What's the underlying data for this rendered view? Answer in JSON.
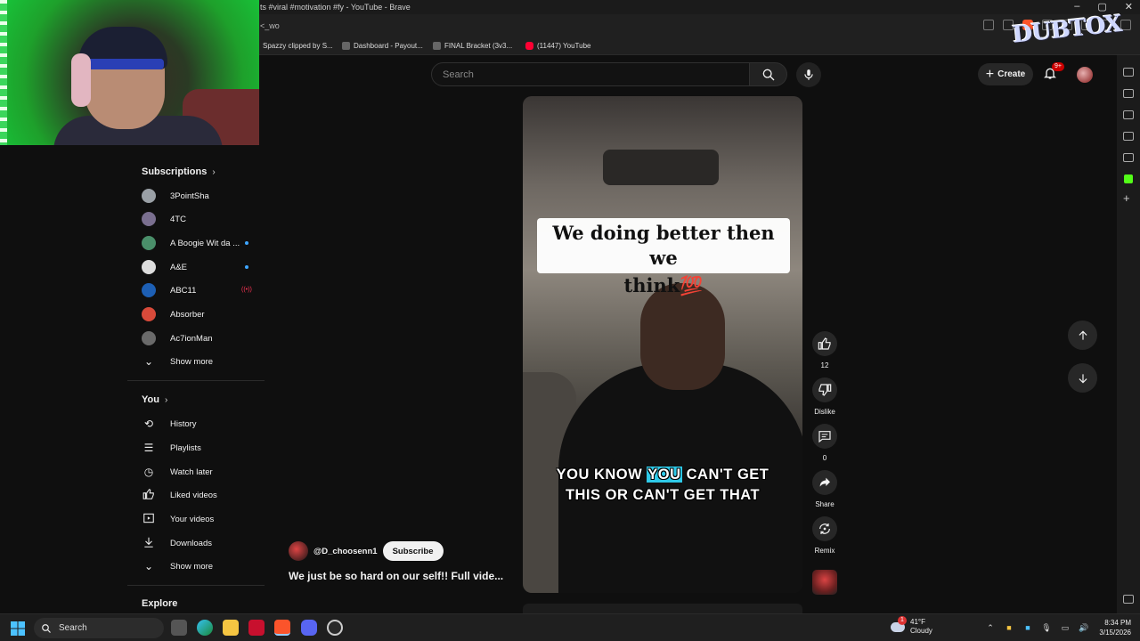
{
  "browser": {
    "window_title": "ts #viral #motivation #fy - YouTube - Brave",
    "url_fragment": "<_wo",
    "bookmarks": [
      {
        "label": "Spazzy clipped by S..."
      },
      {
        "label": "Dashboard - Payout..."
      },
      {
        "label": "FINAL Bracket (3v3..."
      },
      {
        "label": "(11447) YouTube"
      }
    ]
  },
  "header": {
    "search_placeholder": "Search",
    "create_label": "Create",
    "notifications_badge": "9+"
  },
  "guide": {
    "subscriptions_title": "Subscriptions",
    "subscriptions": [
      {
        "label": "3PointSha",
        "color": "#9aa0a6"
      },
      {
        "label": "4TC",
        "color": "#7a6f8f"
      },
      {
        "label": "A Boogie Wit da ...",
        "color": "#4a8f6a"
      },
      {
        "label": "A&E",
        "color": "#dddddd"
      },
      {
        "label": "ABC11",
        "color": "#1d5fb4"
      },
      {
        "label": "Absorber",
        "color": "#d84a3a"
      },
      {
        "label": "Ac7ionMan",
        "color": "#6a6a6a"
      }
    ],
    "show_more_1": "Show more",
    "you_title": "You",
    "you_items": [
      {
        "label": "History",
        "icon": "history-icon",
        "glyph": "⟲"
      },
      {
        "label": "Playlists",
        "icon": "playlists-icon",
        "glyph": "☰"
      },
      {
        "label": "Watch later",
        "icon": "watch-later-icon",
        "glyph": "◷"
      },
      {
        "label": "Liked videos",
        "icon": "thumbs-up-icon",
        "glyph": "👍"
      },
      {
        "label": "Your videos",
        "icon": "your-videos-icon",
        "glyph": "▷"
      },
      {
        "label": "Downloads",
        "icon": "download-icon",
        "glyph": "⤓"
      }
    ],
    "show_more_2": "Show more",
    "explore_title": "Explore"
  },
  "short": {
    "caption_line1": "We doing better then we",
    "caption_line2": "think💯",
    "subtitle_pre": "YOU KNOW ",
    "subtitle_highlight": "YOU",
    "subtitle_post": " CAN'T GET",
    "subtitle_line2": "THIS OR CAN'T GET THAT",
    "channel_handle": "@D_choosenn1",
    "subscribe_label": "Subscribe",
    "title": "We just be so hard on our self!! Full vide..."
  },
  "actions": {
    "like_count": "12",
    "dislike_label": "Dislike",
    "comment_count": "0",
    "share_label": "Share",
    "remix_label": "Remix"
  },
  "taskbar": {
    "search_label": "Search",
    "weather_temp": "41°F",
    "weather_desc": "Cloudy",
    "weather_badge": "1",
    "time": "8:34 PM",
    "date": "3/15/2026"
  },
  "sticker": {
    "text": "DUBTOX"
  }
}
